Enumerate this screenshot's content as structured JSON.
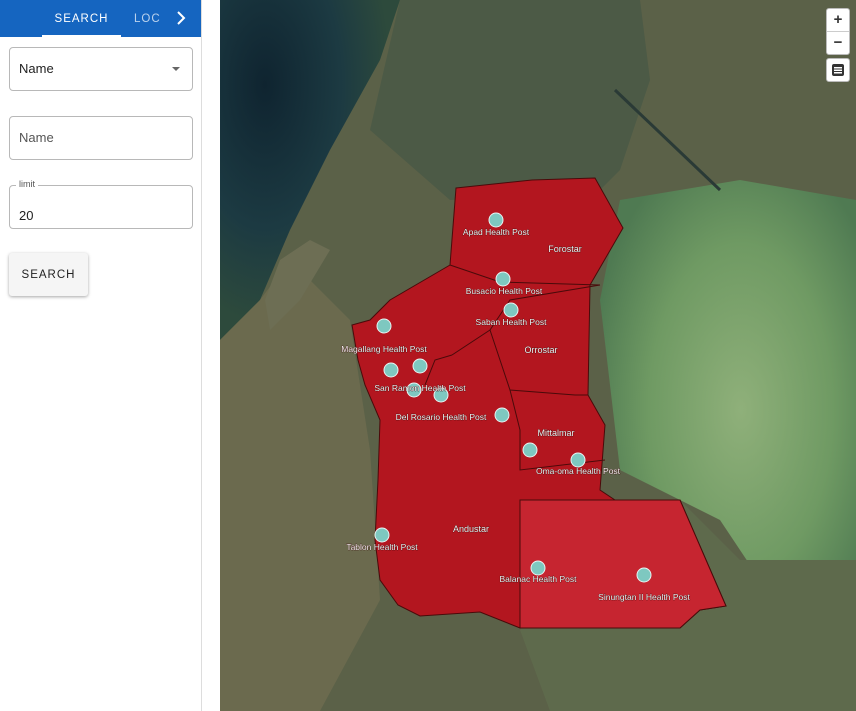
{
  "tabs": [
    {
      "label": "SEARCH",
      "active": true
    },
    {
      "label": "LOC",
      "active": false
    }
  ],
  "tab_next_icon": "chevron-right-icon",
  "form": {
    "select_value": "Name",
    "name_placeholder": "Name",
    "limit_label": "limit",
    "limit_value": "20",
    "search_label": "SEARCH"
  },
  "map": {
    "controls": {
      "zoom_in": "+",
      "zoom_out": "−",
      "layers_icon": "layers-menu-icon"
    },
    "colors": {
      "region_fill": "#b3161f",
      "marker": "#7ec8c0",
      "label_text": "#f2f2f2"
    },
    "region_labels": [
      "Forostar",
      "Orrostar",
      "Mittalmar",
      "Andustar"
    ],
    "marker_labels": [
      "Apad Health Post",
      "Busacio Health Post",
      "Saban Health Post",
      "Magallang Health Post",
      "San Ramon Health Post",
      "Del Rosario Health Post",
      "Oma-oma Health Post",
      "Tablon Health Post",
      "Balanac Health Post",
      "Sinungtan II Health Post"
    ]
  }
}
